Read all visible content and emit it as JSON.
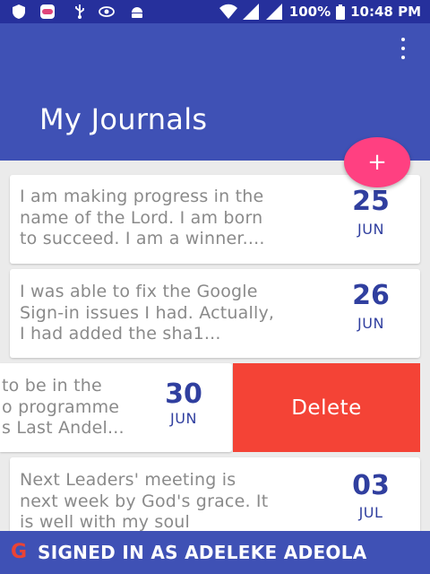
{
  "status_bar": {
    "battery": "100%",
    "time": "10:48 PM",
    "icons": [
      "shield-icon",
      "game-controller-icon",
      "usb-icon",
      "vpn-icon",
      "android-icon",
      "wifi-icon",
      "signal-icon",
      "battery-icon"
    ]
  },
  "app_bar": {
    "title": "My Journals",
    "menu_icon": "more-vert-icon"
  },
  "fab": {
    "label": "+"
  },
  "entries": [
    {
      "text_lines": [
        "I am making progress in the",
        "name of the Lord. I am born",
        "to succeed.  I am a winner...."
      ],
      "day": "25",
      "month": "JUN"
    },
    {
      "text_lines": [
        "I was able to fix the Google",
        "Sign-in issues I had. Actually,",
        "I had added the sha1..."
      ],
      "day": "26",
      "month": "JUN"
    },
    {
      "text_lines": [
        "to be in the",
        "o programme",
        "s Last Andel..."
      ],
      "day": "30",
      "month": "JUN",
      "swipe_action": "Delete"
    },
    {
      "text_lines": [
        "Next Leaders' meeting is",
        "next week by God's grace. It",
        "is well with my soul"
      ],
      "day": "03",
      "month": "JUL"
    }
  ],
  "banner": {
    "logo": "G",
    "text": "SIGNED IN AS ADELEKE ADEOLA"
  },
  "colors": {
    "primary": "#3f51b5",
    "primary_dark": "#26309c",
    "accent": "#ff4081",
    "delete": "#f44336",
    "date": "#303f9f"
  }
}
